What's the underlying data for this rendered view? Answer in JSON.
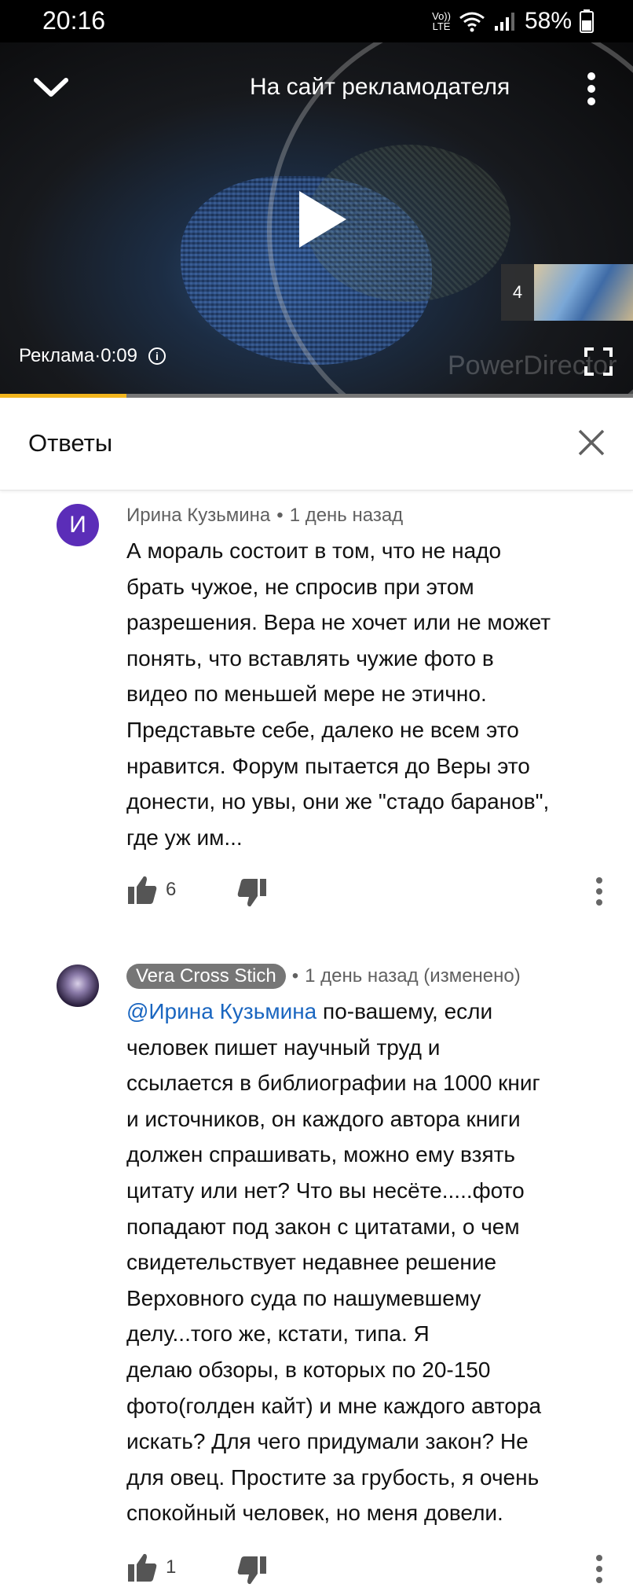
{
  "status_bar": {
    "time": "20:16",
    "network_top": "Vo))",
    "network_bottom": "LTE",
    "battery": "58%"
  },
  "video": {
    "advertiser_link": "На сайт рекламодателя",
    "ad_label": "Реклама·0:09",
    "next_count": "4",
    "watermark": "PowerDirector",
    "progress": 0.2
  },
  "panel": {
    "title": "Ответы"
  },
  "comments": [
    {
      "avatar_letter": "И",
      "author": "Ирина Кузьмина",
      "separator": "•",
      "time": "1 день назад",
      "lines": [
        "А мораль состоит в том, что не надо",
        "брать чужое, не спросив при этом",
        "разрешения. Вера не хочет или не может",
        "понять, что вставлять чужие фото в",
        "видео по меньшей мере не этично.",
        "Представьте себе, далеко не всем это",
        "нравится. Форум пытается до Веры это",
        "донести, но увы, они же \"стадо баранов\",",
        "где уж им..."
      ],
      "likes": "6"
    },
    {
      "author": "Vera Cross Stich",
      "separator": "•",
      "time": "1 день назад (изменено)",
      "mention": "@Ирина Кузьмина",
      "first_line_rest": " по-вашему, если",
      "lines": [
        "человек пишет научный труд и",
        "ссылается в библиографии на 1000 книг",
        "и источников, он каждого автора книги",
        "должен спрашивать, можно ему взять",
        "цитату или нет? Что вы несёте.....фото",
        "попадают под закон с цитатами, о чем",
        "свидетельствует недавнее решение",
        "Верховного суда по нашумевшему",
        "делу...того же, кстати, типа. Я",
        "делаю обзоры, в которых по 20-150",
        "фото(голден кайт) и мне каждого автора",
        "искать? Для чего придумали закон? Не",
        "для овец. Простите за грубость, я очень",
        "спокойный человек, но меня довели."
      ],
      "likes": "1"
    }
  ]
}
